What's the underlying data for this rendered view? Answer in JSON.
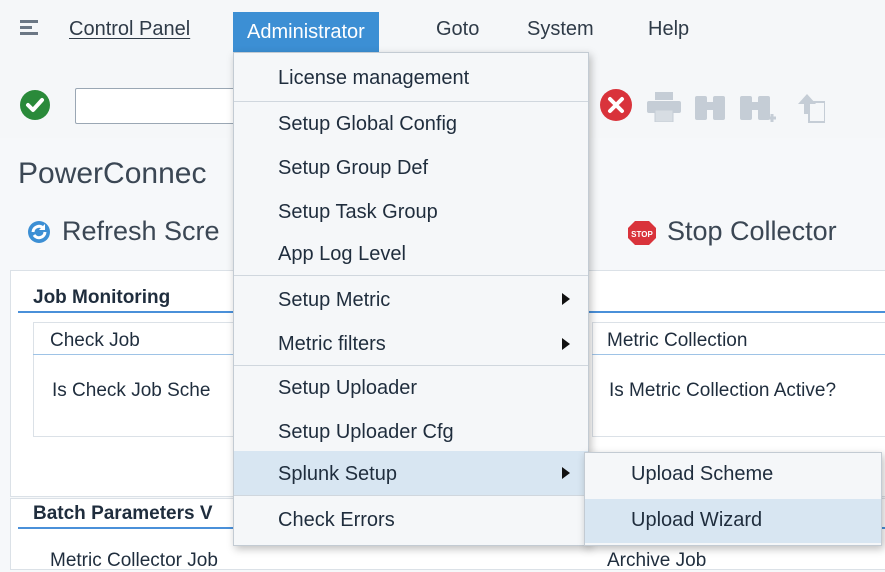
{
  "menubar": {
    "items": [
      {
        "label": "Control Panel",
        "underline": "C"
      },
      {
        "label": "Administrator",
        "underline": "A"
      },
      {
        "label": "Goto",
        "underline": "G"
      },
      {
        "label": "System",
        "underline": "y"
      },
      {
        "label": "Help",
        "underline": "H"
      }
    ]
  },
  "toolbar": {
    "command_field_value": "",
    "icons": [
      "checkmark-icon",
      "cancel-icon",
      "print-icon",
      "find-icon",
      "find-next-icon",
      "upload-icon"
    ]
  },
  "page": {
    "title": "PowerConnec",
    "actions": {
      "refresh_label": "Refresh Scre",
      "stop_label": "Stop Collector"
    }
  },
  "sections": {
    "job_monitoring": "Job Monitoring",
    "check_job": "Check Job",
    "is_check_job_scheduled": "Is Check Job Sche",
    "metric_collection": "Metric Collection",
    "is_metric_collection_active": "Is Metric Collection Active?",
    "batch_parameters": "Batch Parameters V",
    "metric_collector_job": "Metric Collector Job",
    "archive_job": "Archive Job"
  },
  "dropdown": {
    "items": [
      {
        "label": "License management"
      },
      {
        "label": "Setup Global Config"
      },
      {
        "label": "Setup Group Def"
      },
      {
        "label": "Setup Task Group"
      },
      {
        "label": "App Log Level"
      },
      {
        "label": "Setup Metric",
        "has_submenu": true
      },
      {
        "label": "Metric filters",
        "has_submenu": true
      },
      {
        "label": "Setup Uploader"
      },
      {
        "label": "Setup Uploader Cfg"
      },
      {
        "label": "Splunk Setup",
        "has_submenu": true,
        "highlighted": true
      },
      {
        "label": "Check Errors"
      }
    ]
  },
  "submenu": {
    "items": [
      {
        "label": "Upload Scheme"
      },
      {
        "label": "Upload Wizard",
        "highlighted": true
      }
    ]
  },
  "colors": {
    "accent": "#3c8fd4",
    "ok_green": "#2a8a3a",
    "cancel_red": "#d9333b",
    "highlight": "#d8e6f2"
  }
}
